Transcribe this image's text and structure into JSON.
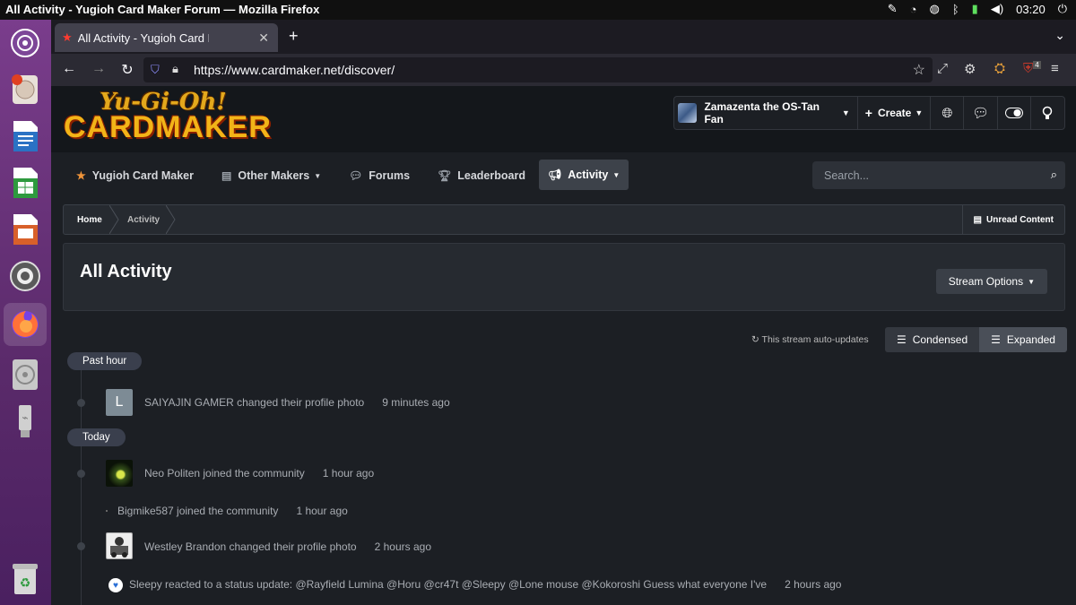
{
  "os": {
    "window_title": "All Activity - Yugioh Card Maker Forum — Mozilla Firefox",
    "clock": "03:20"
  },
  "browser": {
    "tab_title": "All Activity - Yugioh Card Maker Forum",
    "url": "https://www.cardmaker.net/discover/",
    "ublock_count": "4"
  },
  "site": {
    "logo_line1": "Yu-Gi-Oh!",
    "logo_line2": "CARDMAKER",
    "user_name": "Zamazenta the OS-Tan Fan",
    "create_label": "Create",
    "nav": [
      {
        "label": "Yugioh Card Maker",
        "icon": "star-icon"
      },
      {
        "label": "Other Makers",
        "icon": "document-icon"
      },
      {
        "label": "Forums",
        "icon": "chat-icon"
      },
      {
        "label": "Leaderboard",
        "icon": "trophy-icon"
      },
      {
        "label": "Activity",
        "icon": "megaphone-icon"
      }
    ],
    "search_placeholder": "Search..."
  },
  "breadcrumb": {
    "home": "Home",
    "current": "Activity",
    "unread": "Unread Content"
  },
  "main": {
    "title": "All Activity",
    "stream_options": "Stream Options",
    "auto_updates": "This stream auto-updates",
    "view_condensed": "Condensed",
    "view_expanded": "Expanded"
  },
  "activity": {
    "period_past_hour": "Past hour",
    "period_today": "Today",
    "items": [
      {
        "text": "SAIYAJIN GAMER changed their profile photo",
        "time": "9 minutes ago",
        "avatar_letter": "L"
      },
      {
        "text": "Neo Politen joined the community",
        "time": "1 hour ago"
      },
      {
        "text": "Bigmike587 joined the community",
        "time": "1 hour ago"
      },
      {
        "text": "Westley Brandon changed their profile photo",
        "time": "2 hours ago"
      },
      {
        "text": "Sleepy reacted to a status update: @Rayfield Lumina @Horu @cr47t @Sleepy @Lone mouse @Kokoroshi Guess what everyone I've",
        "time": "2 hours ago"
      }
    ]
  }
}
